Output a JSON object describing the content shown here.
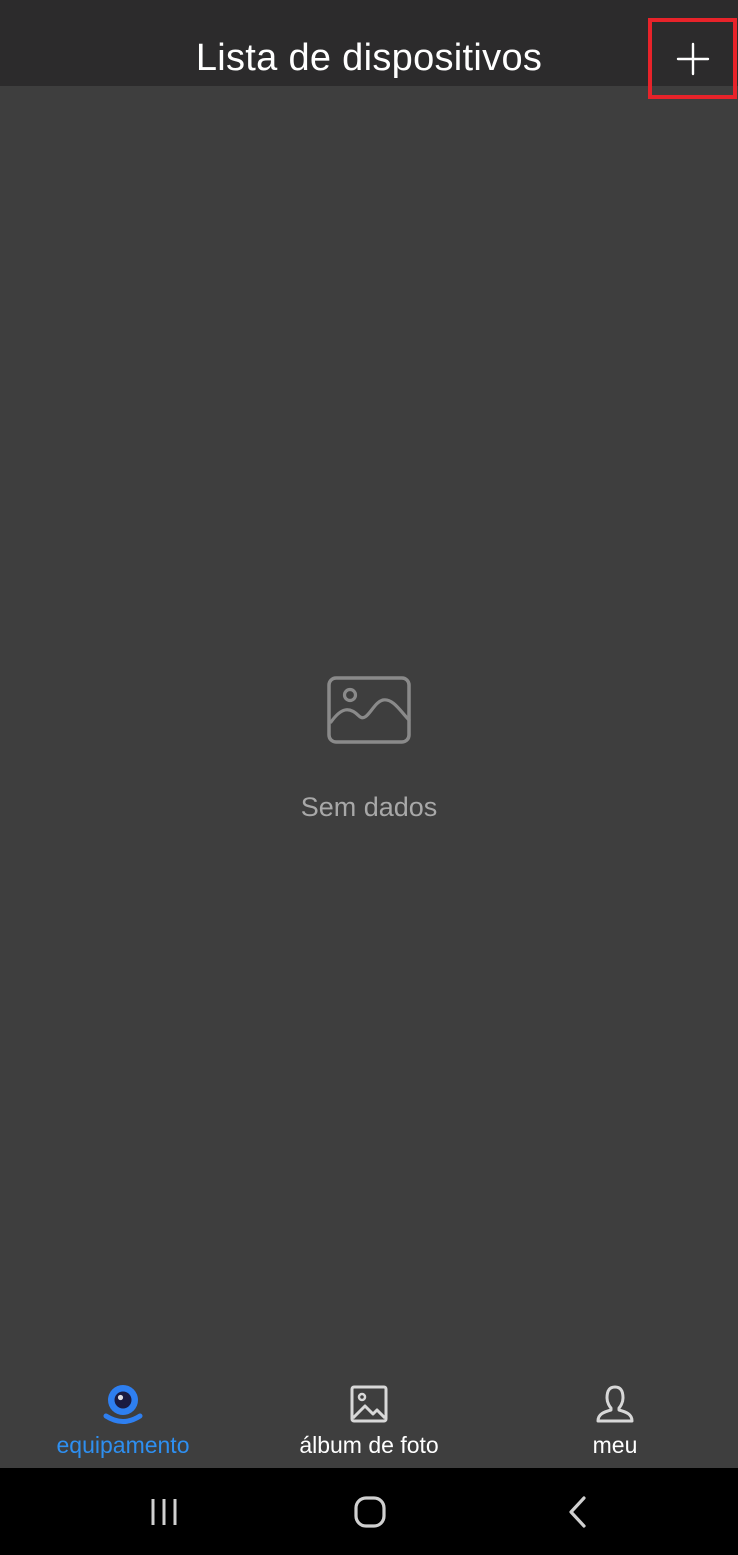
{
  "header": {
    "title": "Lista de dispositivos",
    "add_icon": "plus-icon",
    "highlight_color": "#e8232a"
  },
  "empty_state": {
    "icon": "image-placeholder-icon",
    "message": "Sem dados"
  },
  "tabs": [
    {
      "label": "equipamento",
      "icon": "camera-icon",
      "active": true
    },
    {
      "label": "álbum de foto",
      "icon": "photo-album-icon",
      "active": false
    },
    {
      "label": "meu",
      "icon": "person-icon",
      "active": false
    }
  ],
  "system_nav": {
    "recents_icon": "recents-icon",
    "home_icon": "home-icon",
    "back_icon": "back-icon"
  },
  "colors": {
    "background": "#3e3e3e",
    "app_bar": "#2c2b2c",
    "accent": "#2e8ff0",
    "muted_text": "#a8a8a8"
  }
}
